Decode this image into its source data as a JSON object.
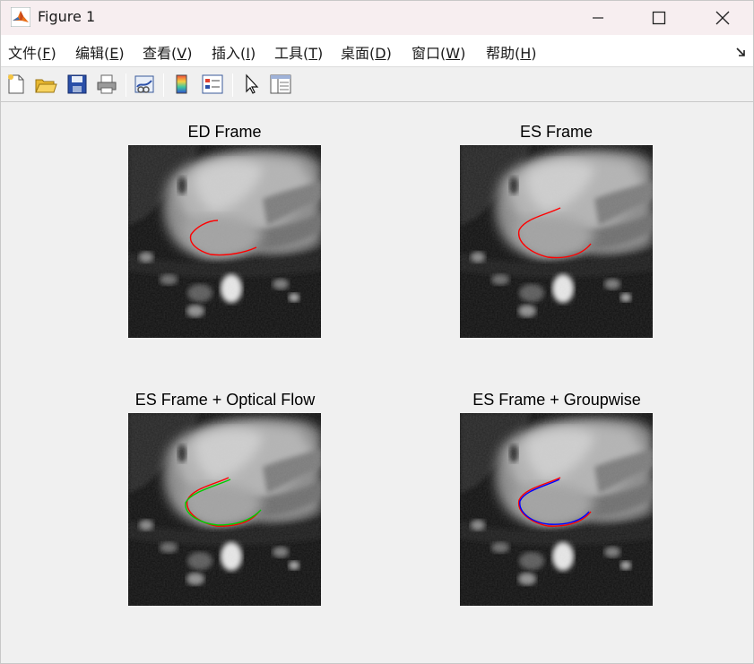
{
  "window": {
    "title": "Figure 1"
  },
  "menu": [
    {
      "label": "文件(",
      "acc": "F",
      "tail": ")",
      "name": "menu-file"
    },
    {
      "label": "编辑(",
      "acc": "E",
      "tail": ")",
      "name": "menu-edit"
    },
    {
      "label": "查看(",
      "acc": "V",
      "tail": ")",
      "name": "menu-view"
    },
    {
      "label": "插入(",
      "acc": "I",
      "tail": ")",
      "name": "menu-insert"
    },
    {
      "label": "工具(",
      "acc": "T",
      "tail": ")",
      "name": "menu-tools"
    },
    {
      "label": "桌面(",
      "acc": "D",
      "tail": ")",
      "name": "menu-desktop"
    },
    {
      "label": "窗口(",
      "acc": "W",
      "tail": ")",
      "name": "menu-window"
    },
    {
      "label": "帮助(",
      "acc": "H",
      "tail": ")",
      "name": "menu-help"
    }
  ],
  "toolbar": {
    "icons": [
      "new-figure-icon",
      "open-file-icon",
      "save-icon",
      "print-icon",
      "link-plot-icon",
      "colorbar-icon",
      "legend-icon",
      "pointer-icon",
      "property-inspector-icon"
    ]
  },
  "plots": [
    {
      "title": "ED Frame",
      "contours": [
        "red"
      ]
    },
    {
      "title": "ES Frame",
      "contours": [
        "red"
      ]
    },
    {
      "title": "ES Frame + Optical Flow",
      "contours": [
        "red",
        "green"
      ]
    },
    {
      "title": "ES Frame + Groupwise",
      "contours": [
        "red",
        "blue"
      ]
    }
  ],
  "colors": {
    "titlebar": "#f7eef0",
    "background": "#f0f0f0",
    "contour_red": "#ff0000",
    "contour_green": "#00cc00",
    "contour_blue": "#0000ff"
  }
}
